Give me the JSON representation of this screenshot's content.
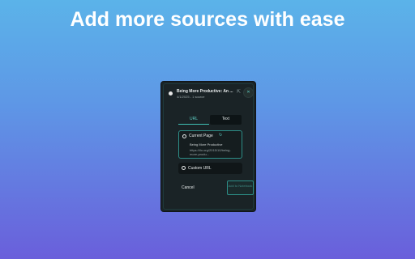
{
  "headline": "Add more sources with ease",
  "panel": {
    "header": {
      "title": "Being More Productive: An ...",
      "subtitle": "4/1/2025 - 1 source",
      "external_icon": "external-link-icon",
      "close_icon": "close-icon",
      "close_glyph": "✕",
      "external_glyph": "⇱"
    },
    "tabs": [
      {
        "label": "URL",
        "active": true
      },
      {
        "label": "Text",
        "active": false
      }
    ],
    "current_page": {
      "label": "Current Page",
      "refresh_glyph": "↻",
      "title": "Being More Productive",
      "url": "https://ilo.org/2015/10/being-more-produ..."
    },
    "custom_url": {
      "label": "Custom URL"
    },
    "cancel_label": "Cancel",
    "add_label": "Add to Notebook"
  },
  "colors": {
    "accent": "#3fbfb3",
    "panel_bg": "#1a2326",
    "gradient_top": "#5bb3e9",
    "gradient_bottom": "#6a5fdb"
  }
}
